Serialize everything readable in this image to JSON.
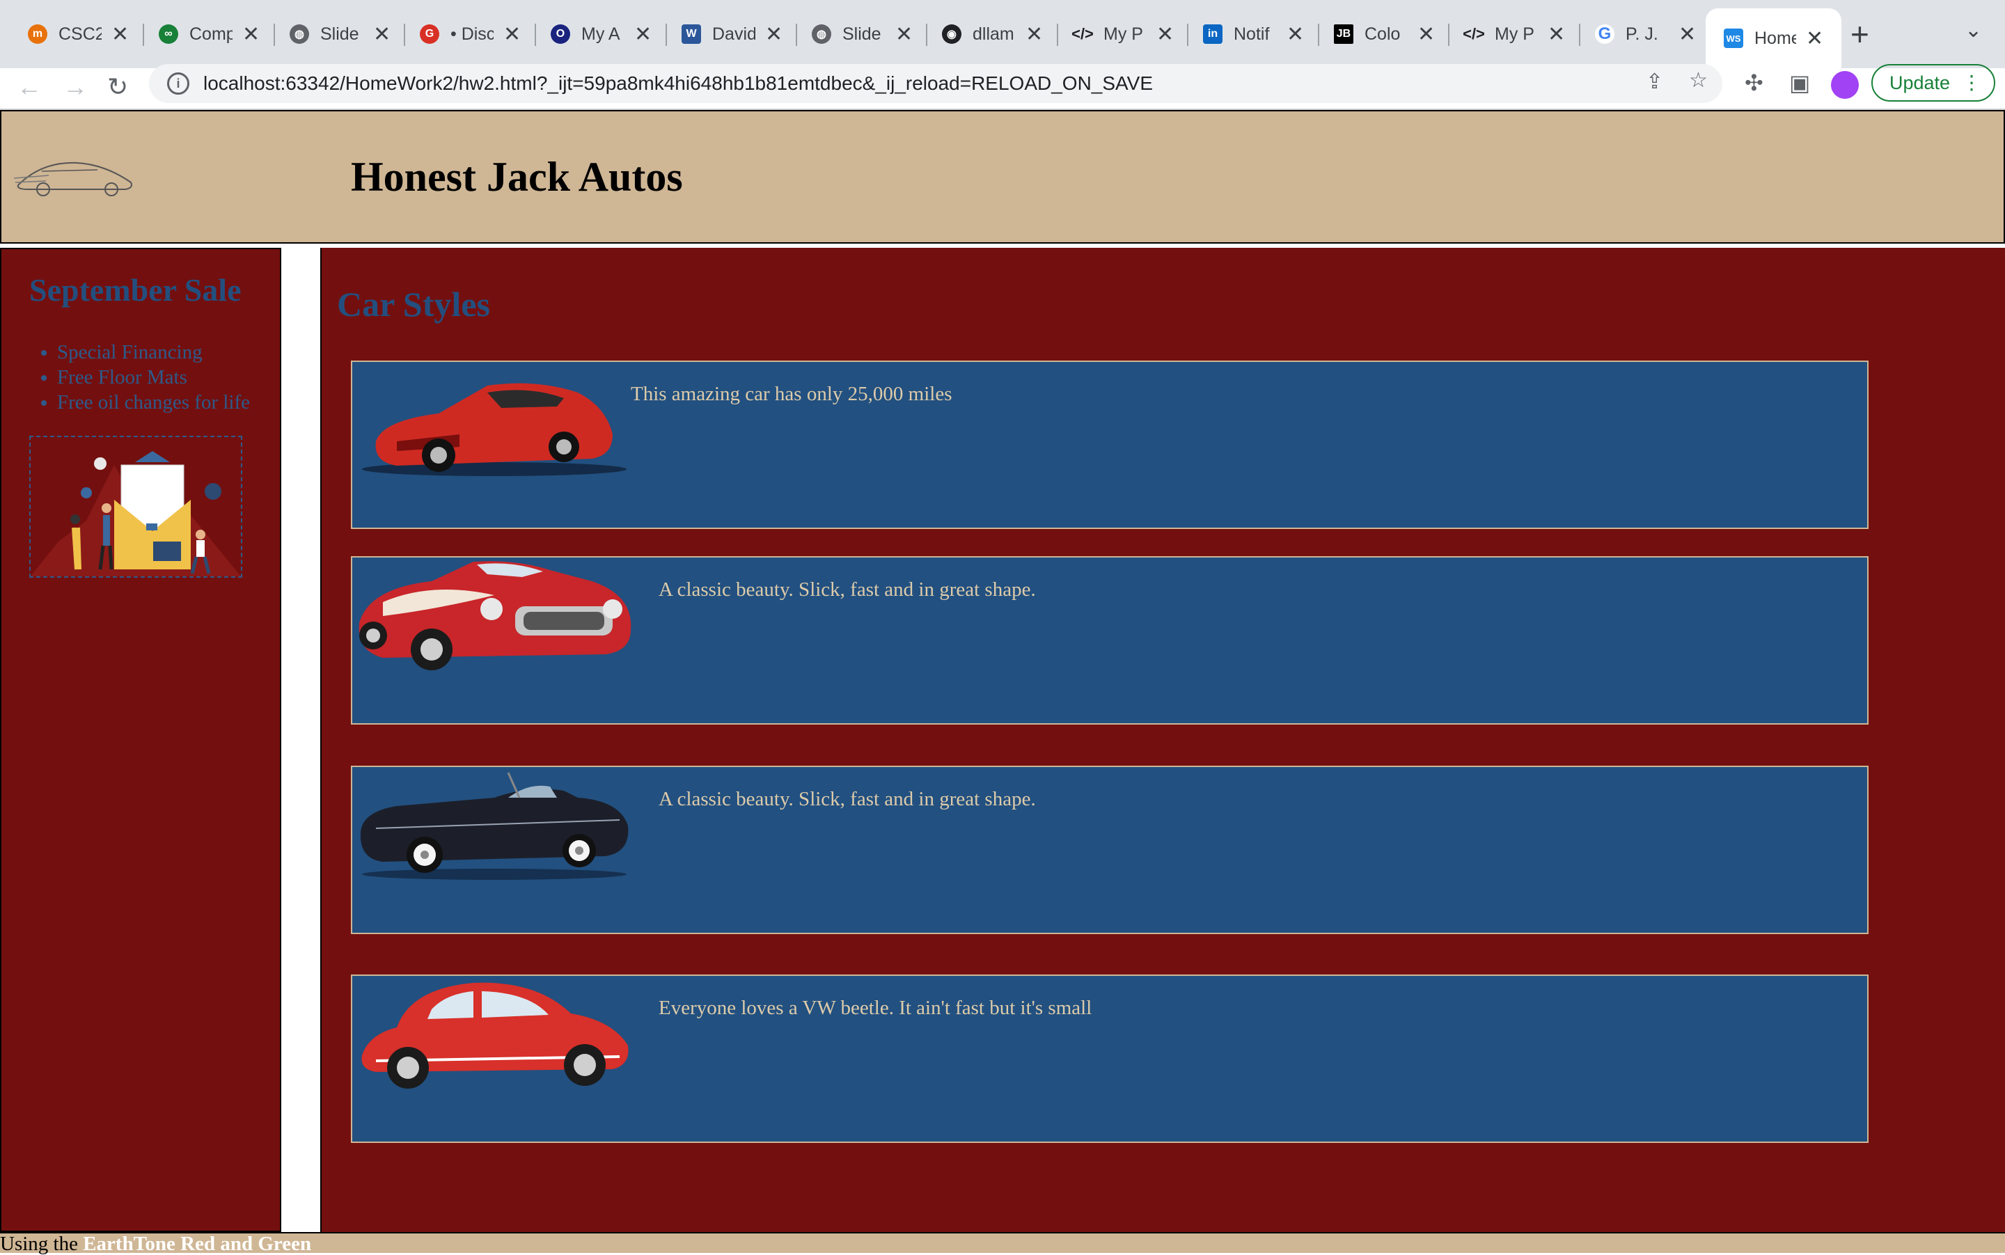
{
  "browser": {
    "tabs": [
      {
        "label": "CSC2",
        "favicon_color": "#e8710a"
      },
      {
        "label": "Comp",
        "favicon_color": "#188038"
      },
      {
        "label": "Slide",
        "favicon_color": "#5f6368"
      },
      {
        "label": "• Disc",
        "favicon_color": "#d93025"
      },
      {
        "label": "My A",
        "favicon_color": "#1a237e"
      },
      {
        "label": "David",
        "favicon_color": "#2b579a"
      },
      {
        "label": "Slide",
        "favicon_color": "#5f6368"
      },
      {
        "label": "dllam",
        "favicon_color": "#202124"
      },
      {
        "label": "My P",
        "favicon_color": "#202124"
      },
      {
        "label": "Notif",
        "favicon_color": "#0a66c2"
      },
      {
        "label": "Colo",
        "favicon_color": "#000000"
      },
      {
        "label": "My P",
        "favicon_color": "#202124"
      },
      {
        "label": "P. J.",
        "favicon_color": "#4285f4"
      }
    ],
    "active_tab": {
      "label": "Home",
      "favicon_color": "#1e88e5"
    },
    "url": "localhost:63342/HomeWork2/hw2.html?_ijt=59pa8mk4hi648hb1b81emtdbec&_ij_reload=RELOAD_ON_SAVE",
    "update_label": "Update"
  },
  "page": {
    "title": "Honest Jack Autos",
    "sidebar": {
      "heading": "September Sale",
      "items": [
        "Special Financing",
        "Free Floor Mats",
        "Free oil changes for life"
      ]
    },
    "main": {
      "heading": "Car Styles",
      "cars": [
        {
          "description": "This amazing car has only 25,000 miles",
          "image": "red-sports-car",
          "color": "#cf2a22"
        },
        {
          "description": "A classic beauty. Slick, fast and in great shape.",
          "image": "classic-corvette",
          "color": "#c8262a"
        },
        {
          "description": "A classic beauty. Slick, fast and in great shape.",
          "image": "black-convertible",
          "color": "#1c1f2a"
        },
        {
          "description": "Everyone loves a VW beetle. It ain't fast but it's small",
          "image": "vw-beetle",
          "color": "#d8302a"
        }
      ]
    },
    "footer": {
      "prefix": "Using the",
      "scheme": "EarthTone Red and Green"
    }
  }
}
